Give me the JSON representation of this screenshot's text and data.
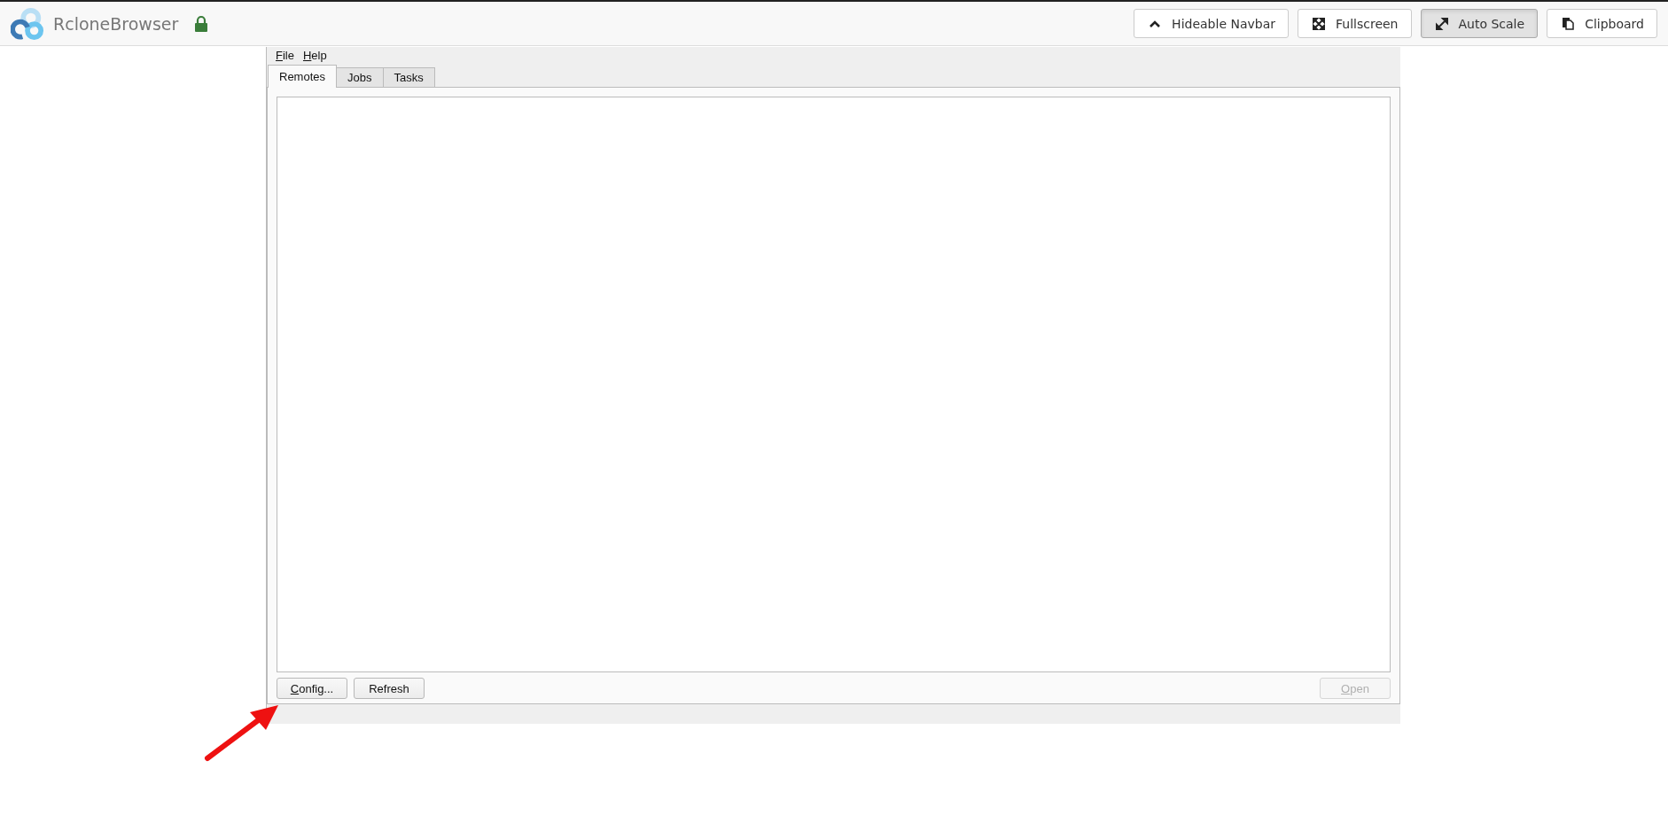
{
  "navbar": {
    "title": "RcloneBrowser",
    "secure": true,
    "buttons": [
      {
        "label": "Hideable Navbar",
        "kind": "chevron",
        "selected": false
      },
      {
        "label": "Fullscreen",
        "kind": "expand",
        "selected": false
      },
      {
        "label": "Auto Scale",
        "kind": "scale",
        "selected": true
      },
      {
        "label": "Clipboard",
        "kind": "clipboard",
        "selected": false
      }
    ]
  },
  "menu": [
    {
      "label": "File",
      "mnemonic": true
    },
    {
      "label": "Help",
      "mnemonic": true
    }
  ],
  "tabs": [
    {
      "label": "Remotes",
      "selected": true
    },
    {
      "label": "Jobs",
      "selected": false
    },
    {
      "label": "Tasks",
      "selected": false
    }
  ],
  "buttons": [
    {
      "label": "Config...",
      "mnemonic": true,
      "disabled": false
    },
    {
      "label": "Refresh",
      "mnemonic": false,
      "disabled": false
    },
    {
      "label": "Open",
      "mnemonic": true,
      "disabled": true
    }
  ],
  "annotation": {
    "arrow": true
  }
}
